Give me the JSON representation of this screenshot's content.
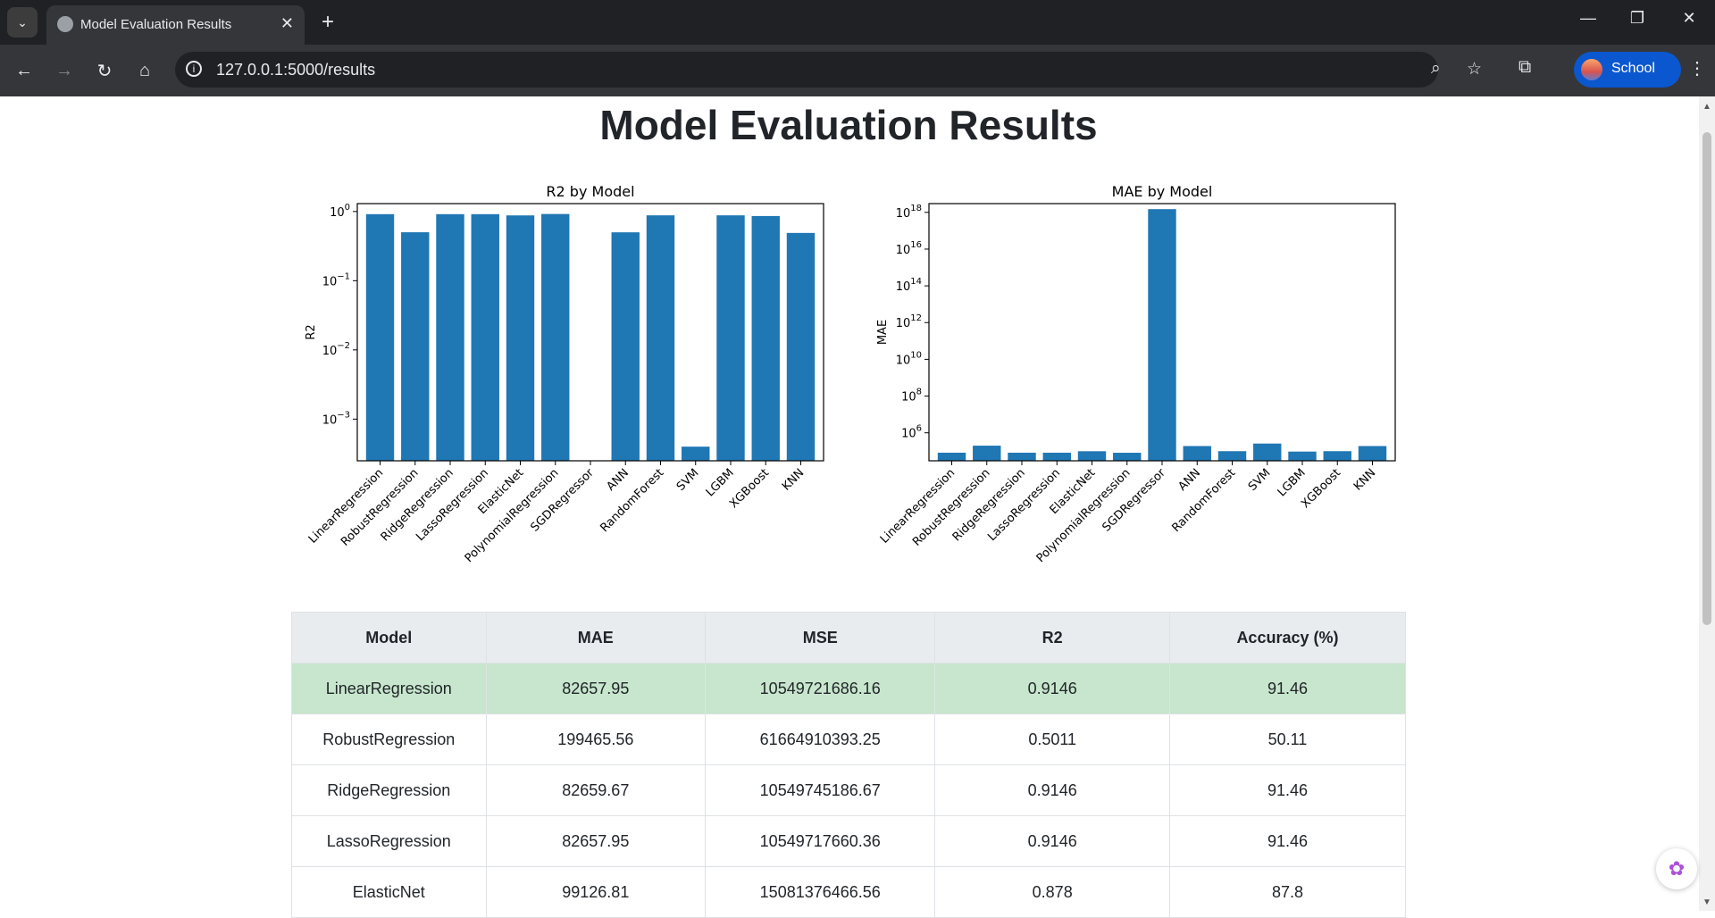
{
  "browser": {
    "tab_title": "Model Evaluation Results",
    "url": "127.0.0.1:5000/results",
    "profile_label": "School"
  },
  "page": {
    "title": "Model Evaluation Results"
  },
  "chart_data": [
    {
      "type": "bar",
      "title": "R2 by Model",
      "xlabel": "",
      "ylabel": "R2",
      "yscale": "log",
      "ylim": [
        0.00025,
        1.3
      ],
      "yticks": [
        {
          "exp": "0",
          "v": 1
        },
        {
          "exp": "−1",
          "v": 0.1
        },
        {
          "exp": "−2",
          "v": 0.01
        },
        {
          "exp": "−3",
          "v": 0.001
        }
      ],
      "categories": [
        "LinearRegression",
        "RobustRegression",
        "RidgeRegression",
        "LassoRegression",
        "ElasticNet",
        "PolynomialRegression",
        "SGDRegressor",
        "ANN",
        "RandomForest",
        "SVM",
        "LGBM",
        "XGBoost",
        "KNN"
      ],
      "values": [
        0.9146,
        0.5011,
        0.9146,
        0.9146,
        0.878,
        0.92,
        null,
        0.5,
        0.88,
        0.0004,
        0.88,
        0.86,
        0.49
      ],
      "color": "#1f77b4",
      "grid": false
    },
    {
      "type": "bar",
      "title": "MAE by Model",
      "xlabel": "",
      "ylabel": "MAE",
      "yscale": "log",
      "ylim": [
        30000,
        3e+18
      ],
      "yticks": [
        {
          "exp": "18",
          "v": 1e+18
        },
        {
          "exp": "16",
          "v": 1e+16
        },
        {
          "exp": "14",
          "v": 100000000000000.0
        },
        {
          "exp": "12",
          "v": 1000000000000.0
        },
        {
          "exp": "10",
          "v": 10000000000.0
        },
        {
          "exp": "8",
          "v": 100000000.0
        },
        {
          "exp": "6",
          "v": 1000000.0
        }
      ],
      "categories": [
        "LinearRegression",
        "RobustRegression",
        "RidgeRegression",
        "LassoRegression",
        "ElasticNet",
        "PolynomialRegression",
        "SGDRegressor",
        "ANN",
        "RandomForest",
        "SVM",
        "LGBM",
        "XGBoost",
        "KNN"
      ],
      "values": [
        82657.95,
        199465.56,
        82659.67,
        82657.95,
        99126.81,
        82000,
        1.5e+18,
        190000,
        100000,
        260000,
        95000,
        100000,
        190000
      ],
      "color": "#1f77b4",
      "grid": false
    }
  ],
  "table": {
    "headers": [
      "Model",
      "MAE",
      "MSE",
      "R2",
      "Accuracy (%)"
    ],
    "rows": [
      [
        "LinearRegression",
        "82657.95",
        "10549721686.16",
        "0.9146",
        "91.46"
      ],
      [
        "RobustRegression",
        "199465.56",
        "61664910393.25",
        "0.5011",
        "50.11"
      ],
      [
        "RidgeRegression",
        "82659.67",
        "10549745186.67",
        "0.9146",
        "91.46"
      ],
      [
        "LassoRegression",
        "82657.95",
        "10549717660.36",
        "0.9146",
        "91.46"
      ],
      [
        "ElasticNet",
        "99126.81",
        "15081376466.56",
        "0.878",
        "87.8"
      ]
    ]
  }
}
